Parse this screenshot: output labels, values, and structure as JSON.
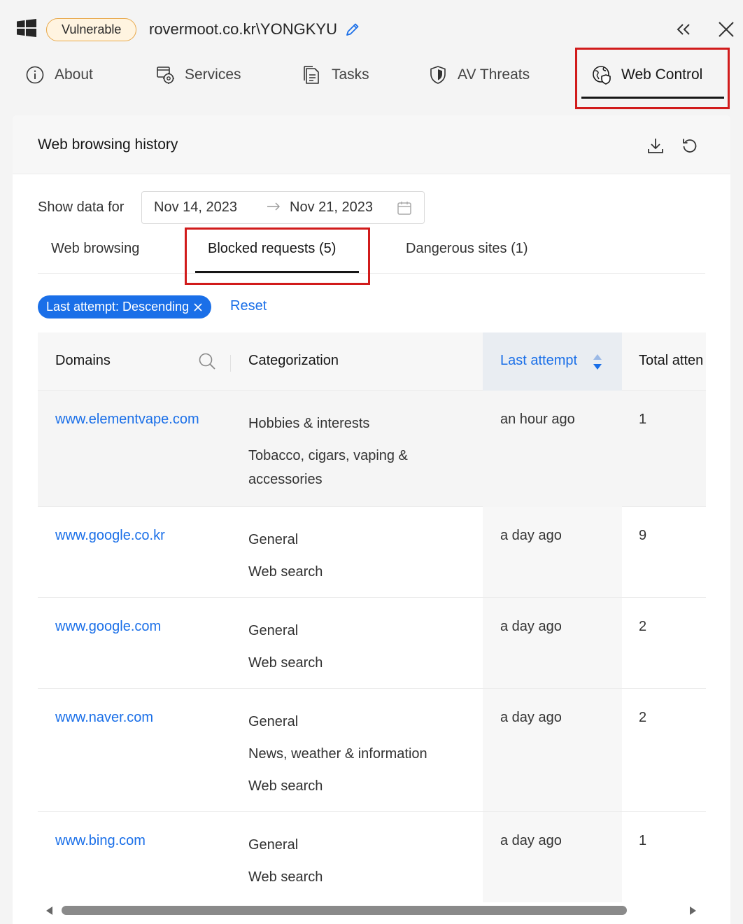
{
  "header": {
    "status_badge": "Vulnerable",
    "machine_name": "rovermoot.co.kr\\YONGKYU"
  },
  "tabs": [
    {
      "label": "About",
      "icon": "info-icon"
    },
    {
      "label": "Services",
      "icon": "services-gear-icon"
    },
    {
      "label": "Tasks",
      "icon": "document-icon"
    },
    {
      "label": "AV Threats",
      "icon": "shield-icon"
    },
    {
      "label": "Web Control",
      "icon": "globe-shield-icon",
      "active": true
    }
  ],
  "card": {
    "title": "Web browsing history",
    "show_data_label": "Show data for",
    "date_from": "Nov 14, 2023",
    "date_to": "Nov 21, 2023"
  },
  "subtabs": [
    {
      "label": "Web browsing"
    },
    {
      "label": "Blocked requests (5)",
      "active": true
    },
    {
      "label": "Dangerous sites (1)"
    }
  ],
  "filter": {
    "chip_label": "Last attempt: Descending",
    "reset_label": "Reset"
  },
  "table": {
    "columns": [
      "Domains",
      "Categorization",
      "Last attempt",
      "Total atten"
    ],
    "rows": [
      {
        "domain": "www.elementvape.com",
        "categories": [
          "Hobbies & interests",
          "Tobacco, cigars, vaping & accessories"
        ],
        "last_attempt": "an hour ago",
        "total": "1"
      },
      {
        "domain": "www.google.co.kr",
        "categories": [
          "General",
          "Web search"
        ],
        "last_attempt": "a day ago",
        "total": "9"
      },
      {
        "domain": "www.google.com",
        "categories": [
          "General",
          "Web search"
        ],
        "last_attempt": "a day ago",
        "total": "2"
      },
      {
        "domain": "www.naver.com",
        "categories": [
          "General",
          "News, weather & information",
          "Web search"
        ],
        "last_attempt": "a day ago",
        "total": "2"
      },
      {
        "domain": "www.bing.com",
        "categories": [
          "General",
          "Web search"
        ],
        "last_attempt": "a day ago",
        "total": "1"
      }
    ]
  },
  "colors": {
    "accent": "#1a6fe8",
    "highlight": "#d11b1b",
    "badge_border": "#e8a84a"
  }
}
